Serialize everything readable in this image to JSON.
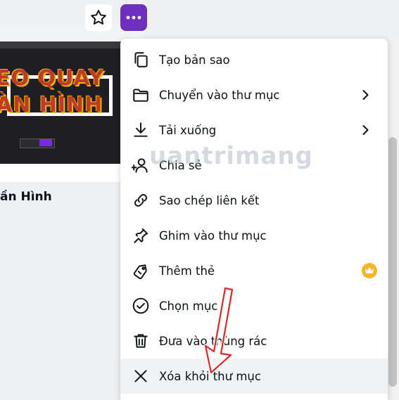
{
  "card": {
    "title": "ần Hình",
    "thumb_text_1": "EO QUAY",
    "thumb_text_2": "ÀN HÌNH"
  },
  "toolbar": {
    "star_icon": "star-icon",
    "more_icon": "more-horizontal-icon",
    "accent": "#6e2fbe"
  },
  "menu": {
    "items": [
      {
        "label": "Tạo bản sao",
        "icon": "copy-icon"
      },
      {
        "label": "Chuyển vào thư mục",
        "icon": "folder-icon",
        "submenu": true
      },
      {
        "label": "Tải xuống",
        "icon": "download-icon",
        "submenu": true
      },
      {
        "label": "Chia sẻ",
        "icon": "share-people-icon"
      },
      {
        "label": "Sao chép liên kết",
        "icon": "link-icon"
      },
      {
        "label": "Ghim vào thư mục",
        "icon": "pin-icon"
      },
      {
        "label": "Thêm thẻ",
        "icon": "tag-icon",
        "premium": true
      },
      {
        "label": "Chọn mục",
        "icon": "check-circle-icon"
      },
      {
        "label": "Đưa vào thùng rác",
        "icon": "trash-icon"
      },
      {
        "label": "Xóa khỏi thư mục",
        "icon": "close-icon"
      }
    ]
  },
  "watermark": "uantrimang",
  "colors": {
    "premium_badge": "#f4b528",
    "annotation_arrow": "#d42a2a"
  }
}
